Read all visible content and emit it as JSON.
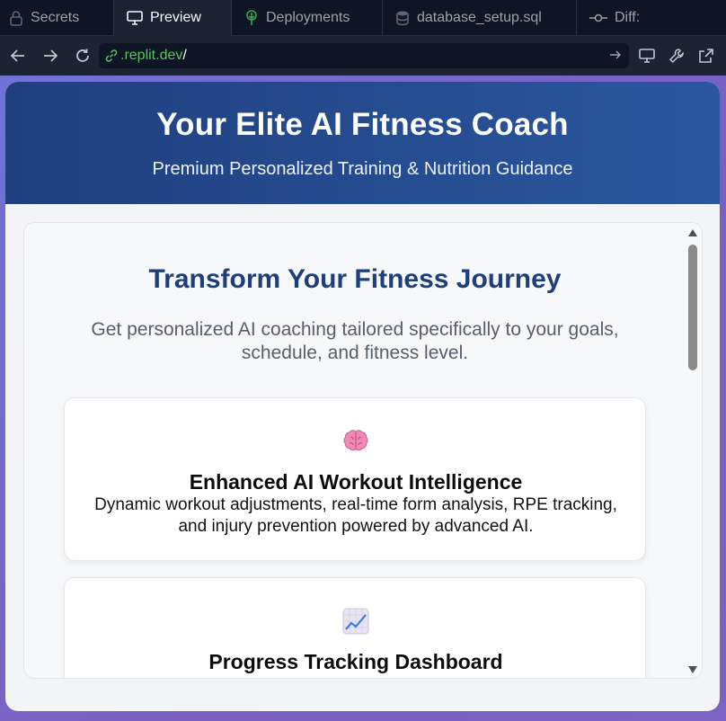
{
  "tabs": [
    {
      "label": "Secrets",
      "icon": "lock-icon"
    },
    {
      "label": "Preview",
      "icon": "monitor-icon"
    },
    {
      "label": "Deployments",
      "icon": "deploy-icon"
    },
    {
      "label": "database_setup.sql",
      "icon": "database-icon"
    },
    {
      "label": "Diff:",
      "icon": "commit-icon"
    }
  ],
  "urlbar": {
    "host": ".replit.dev",
    "path": "/"
  },
  "app": {
    "title": "Your Elite AI Fitness Coach",
    "subtitle": "Premium Personalized Training & Nutrition Guidance",
    "heading": "Transform Your Fitness Journey",
    "lead": "Get personalized AI coaching tailored specifically to your goals, schedule, and fitness level.",
    "cards": [
      {
        "icon": "brain-icon",
        "title": "Enhanced AI Workout Intelligence",
        "text": "Dynamic workout adjustments, real-time form analysis, RPE tracking, and injury prevention powered by advanced AI."
      },
      {
        "icon": "chart-increasing-icon",
        "title": "Progress Tracking Dashboard",
        "text": ""
      }
    ]
  },
  "colors": {
    "header_start": "#1f3f7e",
    "header_end": "#2b579f",
    "heading": "#1e3f7a",
    "url_host": "#58c55b",
    "frame_border": "#7163cf"
  }
}
